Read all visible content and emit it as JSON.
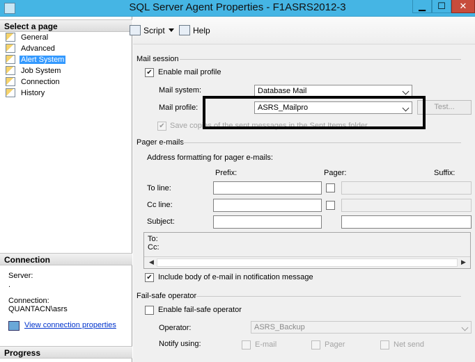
{
  "window": {
    "title": "SQL Server Agent Properties - F1ASRS2012-3",
    "minimize": "▁",
    "maximize": "☐",
    "close": "✕"
  },
  "left_pane": {
    "select_page_header": "Select a page",
    "pages": [
      {
        "label": "General",
        "selected": false
      },
      {
        "label": "Advanced",
        "selected": false
      },
      {
        "label": "Alert System",
        "selected": true
      },
      {
        "label": "Job System",
        "selected": false
      },
      {
        "label": "Connection",
        "selected": false
      },
      {
        "label": "History",
        "selected": false
      }
    ],
    "connection_header": "Connection",
    "server_label": "Server:",
    "server_value": ".",
    "connection_label": "Connection:",
    "connection_value": "QUANTACN\\asrs",
    "view_connection_properties": "View connection properties",
    "progress_header": "Progress"
  },
  "toolbar": {
    "script_label": "Script",
    "help_label": "Help"
  },
  "mail_session": {
    "group_title": "Mail session",
    "enable_mail_profile_label": "Enable mail profile",
    "enable_mail_profile_checked": true,
    "mail_system_label": "Mail system:",
    "mail_system_value": "Database Mail",
    "mail_profile_label": "Mail profile:",
    "mail_profile_value": "ASRS_Mailpro",
    "test_button": "Test...",
    "save_copies_label": "Save copies of the sent messages in the Sent Items folder",
    "save_copies_checked": true
  },
  "pager_emails": {
    "group_title": "Pager e-mails",
    "address_formatting_label": "Address formatting for pager e-mails:",
    "col_prefix": "Prefix:",
    "col_pager": "Pager:",
    "col_suffix": "Suffix:",
    "to_line_label": "To line:",
    "cc_line_label": "Cc line:",
    "subject_label": "Subject:",
    "preview_to": "To:",
    "preview_cc": "Cc:",
    "include_body_label": "Include body of e-mail in notification message",
    "include_body_checked": true
  },
  "failsafe": {
    "group_title": "Fail-safe operator",
    "enable_label": "Enable fail-safe operator",
    "enable_checked": false,
    "operator_label": "Operator:",
    "operator_value": "ASRS_Backup",
    "notify_using_label": "Notify using:",
    "email_label": "E-mail",
    "pager_label": "Pager",
    "netsend_label": "Net send"
  }
}
